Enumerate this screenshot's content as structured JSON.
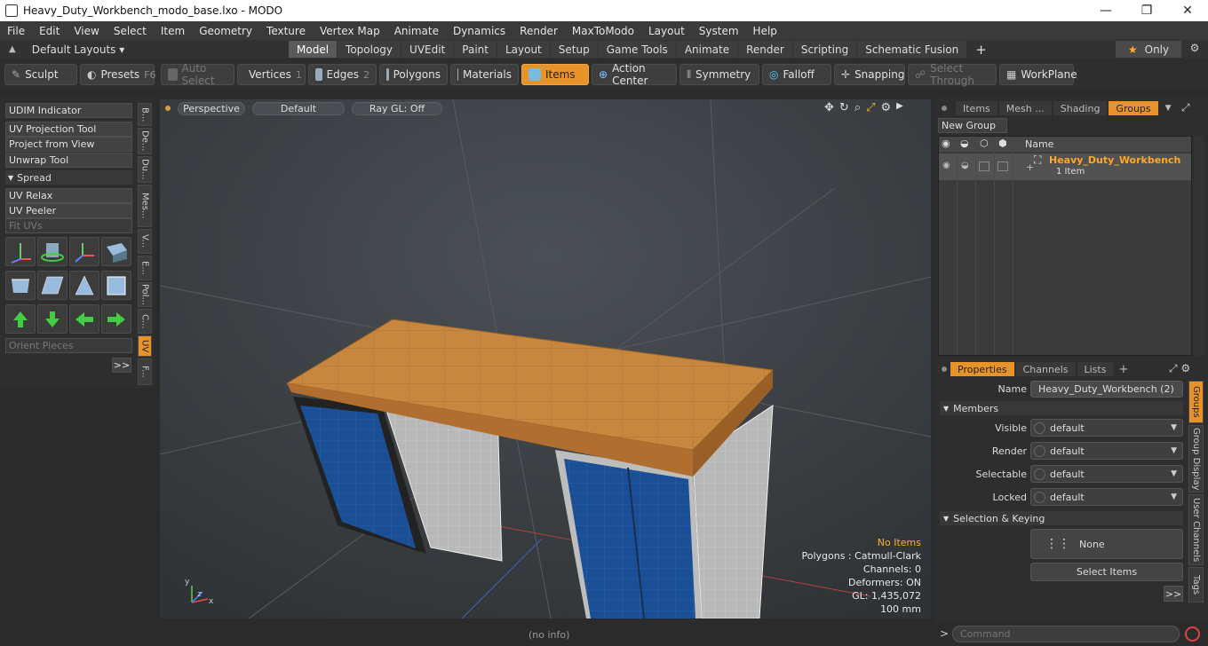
{
  "window": {
    "title": "Heavy_Duty_Workbench_modo_base.lxo - MODO",
    "min": "—",
    "max": "❐",
    "close": "✕"
  },
  "menu": [
    "File",
    "Edit",
    "View",
    "Select",
    "Item",
    "Geometry",
    "Texture",
    "Vertex Map",
    "Animate",
    "Dynamics",
    "Render",
    "MaxToModo",
    "Layout",
    "System",
    "Help"
  ],
  "tabs": {
    "layouts_label": "Default Layouts ▾",
    "items": [
      "Model",
      "Topology",
      "UVEdit",
      "Paint",
      "Layout",
      "Setup",
      "Game Tools",
      "Animate",
      "Render",
      "Scripting",
      "Schematic Fusion"
    ],
    "active": "Model",
    "add": "+",
    "only": "Only",
    "star": "★"
  },
  "toolbar": {
    "sculpt": "Sculpt",
    "presets": "Presets",
    "presets_key": "F6",
    "auto_select": "Auto Select",
    "vertices": "Vertices",
    "vertices_key": "1",
    "edges": "Edges",
    "edges_key": "2",
    "polygons": "Polygons",
    "materials": "Materials",
    "items": "Items",
    "action_center": "Action Center",
    "symmetry": "Symmetry",
    "falloff": "Falloff",
    "snapping": "Snapping",
    "select_through": "Select Through",
    "workplane": "WorkPlane"
  },
  "left": {
    "udim": "UDIM Indicator",
    "uv_projection": "UV Projection Tool",
    "project_from_view": "Project from View",
    "unwrap": "Unwrap Tool",
    "spread": "Spread",
    "uv_relax": "UV Relax",
    "uv_peeler": "UV Peeler",
    "fit_uvs": "Fit UVs",
    "orient": "Orient Pieces",
    "more": ">>",
    "vtabs": [
      "B...",
      "De...",
      "Du...",
      "Mes...",
      "V...",
      "E...",
      "Pol...",
      "C...",
      "UV",
      "F..."
    ]
  },
  "viewport": {
    "perspective": "Perspective",
    "default": "Default",
    "raygl": "Ray GL: Off",
    "stats": {
      "no_items": "No Items",
      "polygons": "Polygons : Catmull-Clark",
      "channels": "Channels: 0",
      "deformers": "Deformers: ON",
      "gl": "GL: 1,435,072",
      "scale": "100 mm"
    }
  },
  "right": {
    "tabs": [
      "Items",
      "Mesh ...",
      "Shading",
      "Groups"
    ],
    "active_tab": "Groups",
    "new_group": "New Group",
    "name_col": "Name",
    "group_name": "Heavy_Duty_Workbench",
    "group_count": "1 Item",
    "prop_tabs": [
      "Properties",
      "Channels",
      "Lists"
    ],
    "prop_name_label": "Name",
    "prop_name_value": "Heavy_Duty_Workbench (2)",
    "members": "Members",
    "visible_label": "Visible",
    "render_label": "Render",
    "selectable_label": "Selectable",
    "locked_label": "Locked",
    "dd_value": "default",
    "sel_keying": "Selection & Keying",
    "none": "None",
    "select_items": "Select Items",
    "more": ">>",
    "vtabs": [
      "Groups",
      "Group Display",
      "User Channels",
      "Tags"
    ]
  },
  "status": {
    "no_info": "(no info)",
    "command_placeholder": "Command",
    "prompt": ">"
  }
}
